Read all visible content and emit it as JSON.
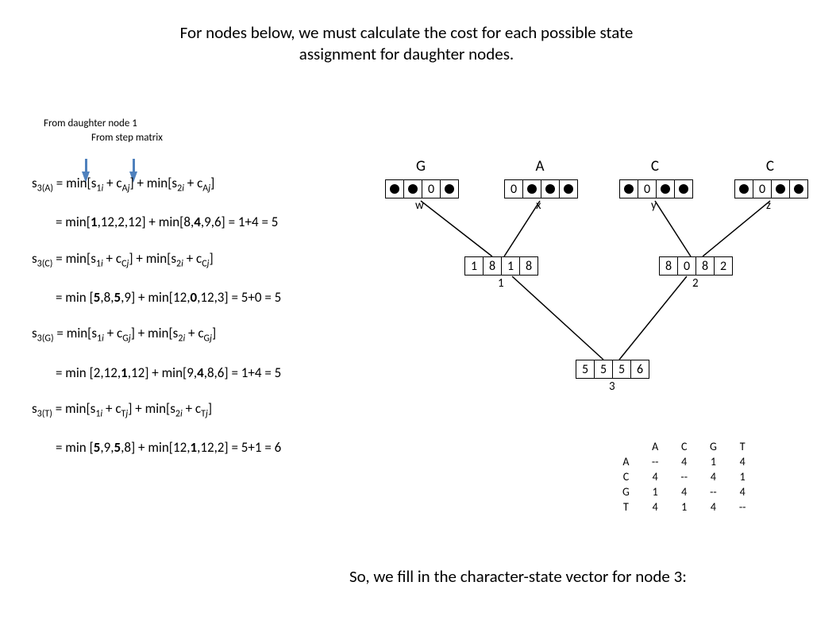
{
  "title_line1": "For nodes below, we must calculate the cost for each possible state",
  "title_line2": "assignment for daughter nodes.",
  "annotation1": "From daughter node 1",
  "annotation2": "From step matrix",
  "eq": {
    "s3A_lhs": "s",
    "s3A_sub": "3(A)",
    "min_txt": " = min[s",
    "sub1i": "1",
    "plusC": " + c",
    "subAj": "A",
    "close_plus_min": "] + min[s",
    "sub2i": "2",
    "close": "]",
    "s3A_val": "= min[1,12,2,12] + min[8,4,9,6] = 1+4 = 5",
    "s3C_sub": "3(C)",
    "subCj": "C",
    "s3C_val": "= min [5,8,5,9] + min[12,0,12,3] = 5+0 = 5",
    "s3G_sub": "3(G)",
    "subGj": "G",
    "s3G_val": "= min [2,12,1,12] + min[9,4,8,6] = 1+4 = 5",
    "s3T_sub": "3(T)",
    "subTj": "T",
    "s3T_val": "= min [5,9,5,8] + min[12,1,12,2] = 5+1 = 6",
    "i": "i",
    "j": "j"
  },
  "leaves": {
    "G": "G",
    "A": "A",
    "C1": "C",
    "C2": "C",
    "w": "w",
    "x": "x",
    "y": "y",
    "z": "z"
  },
  "node_labels": {
    "n1": "1",
    "n2": "2",
    "n3": "3"
  },
  "leaf_states": {
    "w": [
      "dot",
      "dot",
      "0",
      "dot"
    ],
    "x": [
      "0",
      "dot",
      "dot",
      "dot"
    ],
    "y": [
      "dot",
      "0",
      "dot",
      "dot"
    ],
    "z": [
      "dot",
      "0",
      "dot",
      "dot"
    ]
  },
  "internal_nodes": {
    "n1": [
      "1",
      "8",
      "1",
      "8"
    ],
    "n2": [
      "8",
      "0",
      "8",
      "2"
    ],
    "n3": [
      "5",
      "5",
      "5",
      "6"
    ]
  },
  "matrix": {
    "headers": [
      "",
      "A",
      "C",
      "G",
      "T"
    ],
    "rows": [
      [
        "A",
        "--",
        "4",
        "1",
        "4"
      ],
      [
        "C",
        "4",
        "--",
        "4",
        "1"
      ],
      [
        "G",
        "1",
        "4",
        "--",
        "4"
      ],
      [
        "T",
        "4",
        "1",
        "4",
        "--"
      ]
    ]
  },
  "footer": "So, we fill in the character-state vector for node 3:"
}
